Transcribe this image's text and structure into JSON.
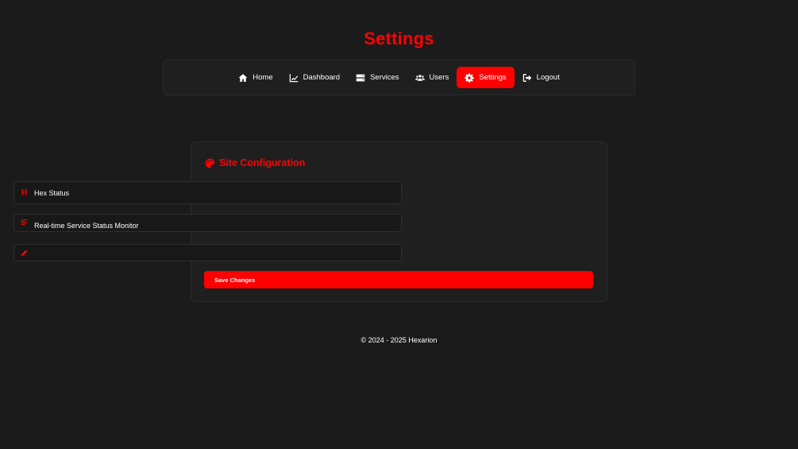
{
  "page": {
    "title": "Settings"
  },
  "nav": {
    "items": [
      {
        "label": "Home",
        "icon": "home-icon",
        "active": false
      },
      {
        "label": "Dashboard",
        "icon": "chart-line-icon",
        "active": false
      },
      {
        "label": "Services",
        "icon": "server-icon",
        "active": false
      },
      {
        "label": "Users",
        "icon": "users-icon",
        "active": false
      },
      {
        "label": "Settings",
        "icon": "gear-icon",
        "active": true
      },
      {
        "label": "Logout",
        "icon": "logout-icon",
        "active": false
      }
    ]
  },
  "config": {
    "title": "Site Configuration",
    "title_icon": "palette-icon",
    "fields": [
      {
        "icon": "heading-icon",
        "icon_text": "H",
        "value": "Hex Status",
        "placeholder": ""
      },
      {
        "icon": "align-left-icon",
        "value": "Real-time Service Status Monitor",
        "placeholder": ""
      },
      {
        "icon": "pencil-icon",
        "value": "",
        "placeholder": ""
      }
    ],
    "save_label": "Save Changes"
  },
  "footer": {
    "text": "© 2024 - 2025 Hexarion"
  },
  "colors": {
    "accent": "#ff0000",
    "background": "#1b1b1b",
    "panel": "#1f1f1f"
  }
}
